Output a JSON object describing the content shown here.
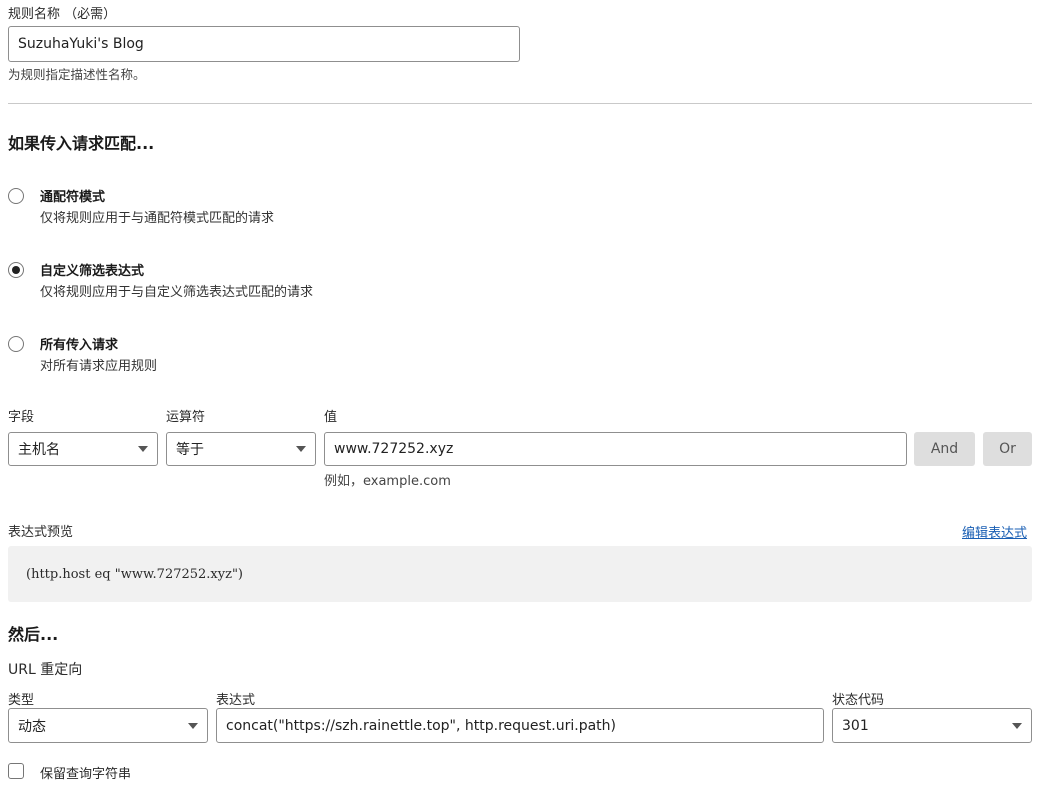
{
  "rule_name": {
    "label": "规则名称 （必需）",
    "value": "SuzuhaYuki's Blog",
    "help": "为规则指定描述性名称。"
  },
  "match": {
    "heading": "如果传入请求匹配...",
    "options": [
      {
        "title": "通配符模式",
        "desc": "仅将规则应用于与通配符模式匹配的请求",
        "selected": false
      },
      {
        "title": "自定义筛选表达式",
        "desc": "仅将规则应用于与自定义筛选表达式匹配的请求",
        "selected": true
      },
      {
        "title": "所有传入请求",
        "desc": "对所有请求应用规则",
        "selected": false
      }
    ]
  },
  "filter": {
    "field_label": "字段",
    "field_value": "主机名",
    "operator_label": "运算符",
    "operator_value": "等于",
    "value_label": "值",
    "value_value": "www.727252.xyz",
    "value_help": "例如，example.com",
    "and_label": "And",
    "or_label": "Or"
  },
  "preview": {
    "label": "表达式预览",
    "edit_link": "编辑表达式",
    "expression": "(http.host eq \"www.727252.xyz\")"
  },
  "then": {
    "heading": "然后...",
    "action": "URL 重定向",
    "type_label": "类型",
    "type_value": "动态",
    "expr_label": "表达式",
    "expr_value": "concat(\"https://szh.rainettle.top\", http.request.uri.path)",
    "status_label": "状态代码",
    "status_value": "301",
    "preserve_query_label": "保留查询字符串",
    "preserve_query_checked": false
  }
}
